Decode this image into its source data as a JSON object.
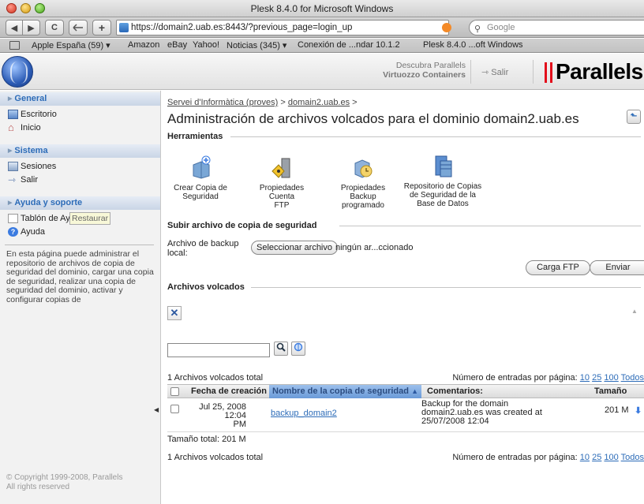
{
  "window": {
    "title": "Plesk 8.4.0 for Microsoft Windows"
  },
  "toolbar": {
    "url": "https://domain2.uab.es:8443/?previous_page=login_up",
    "search_placeholder": "Google",
    "back_glyph": "◀",
    "forward_glyph": "▶",
    "reload_glyph": "C",
    "add_glyph": "+"
  },
  "bookmarks": [
    "Apple España (59) ▾",
    "Amazon",
    "eBay",
    "Yahoo!",
    "Noticias (345) ▾",
    "Conexión de ...ndar 10.1.2",
    "Plesk 8.4.0 ...oft Windows"
  ],
  "header": {
    "promo_line1": "Descubra Parallels",
    "promo_line2": "Virtuozzo Containers",
    "logout_label": "Salir",
    "brand": "Parallels"
  },
  "sidebar": {
    "groups": [
      {
        "title": "General",
        "items": [
          "Escritorio",
          "Inicio"
        ]
      },
      {
        "title": "Sistema",
        "items": [
          "Sesiones",
          "Salir"
        ]
      },
      {
        "title": "Ayuda y soporte",
        "items": [
          "Tablón de Ayuda",
          "Ayuda"
        ]
      }
    ],
    "tooltip": "Restaurar",
    "help_text": "En esta página puede administrar el repositorio de archivos de copia de seguridad del dominio, cargar una copia de seguridad, realizar una copia de seguridad del dominio, activar y configurar copias de",
    "copyright_line1": "© Copyright 1999-2008, Parallels",
    "copyright_line2": "All rights reserved"
  },
  "main": {
    "breadcrumb": {
      "part1": "Servei d'Informàtica (proves)",
      "sep1": ">",
      "part2": "domain2.uab.es",
      "sep2": ">"
    },
    "title": "Administración de archivos volcados para el dominio domain2.uab.es",
    "tools_section": "Herramientas",
    "tools": [
      {
        "label_line1": "Crear Copia de",
        "label_line2": "Seguridad",
        "label_line3": ""
      },
      {
        "label_line1": "Propiedades Cuenta",
        "label_line2": "FTP",
        "label_line3": ""
      },
      {
        "label_line1": "Propiedades Backup",
        "label_line2": "programado",
        "label_line3": ""
      },
      {
        "label_line1": "Repositorio de Copias",
        "label_line2": "de Seguridad de la",
        "label_line3": "Base de Datos"
      }
    ],
    "upload_section": "Subir archivo de copia de seguridad",
    "backup_label_line1": "Archivo de backup",
    "backup_label_line2": "local:",
    "choose_file": "Seleccionar archivo",
    "no_file": "ningún ar...ccionado",
    "ftp_upload": "Carga FTP",
    "send": "Enviar",
    "dumps_section": "Archivos volcados",
    "delete_glyph": "✕",
    "totals_top": "1 Archivos volcados total",
    "totals_bottom": "1 Archivos volcados total",
    "perpage_label": "Número de entradas por página:",
    "perpage_options": [
      "10",
      "25",
      "100",
      "Todos"
    ],
    "table": {
      "headers": [
        "Fecha de creación",
        "Nombre de la copia de seguridad",
        "Comentarios:",
        "Tamaño"
      ],
      "sort_indicator": "▲",
      "rows": [
        {
          "date_line1": "Jul 25, 2008 12:04",
          "date_line2": "PM",
          "name": "backup_domain2",
          "comment_line1": "Backup for the domain",
          "comment_line2": "domain2.uab.es was created at",
          "comment_line3": "25/07/2008 12:04",
          "size": "201 M"
        }
      ],
      "total_size": "Tamaño total: 201 M"
    }
  }
}
